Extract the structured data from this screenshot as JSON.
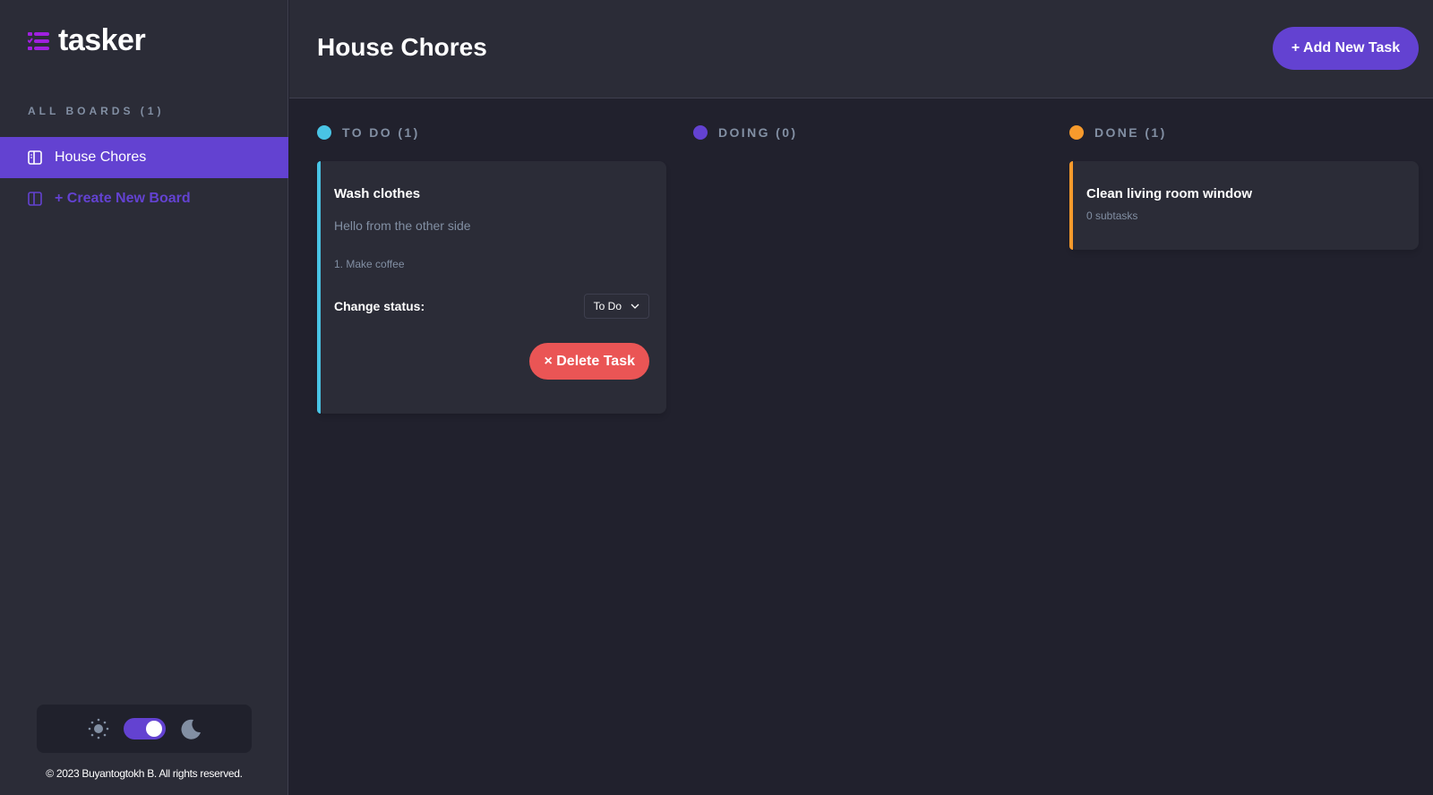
{
  "app": {
    "name": "tasker"
  },
  "sidebar": {
    "all_boards_label": "ALL BOARDS (1)",
    "boards": [
      {
        "label": "House Chores",
        "active": true
      }
    ],
    "create_label": "+ Create New Board",
    "theme": {
      "dark_mode": true
    },
    "footer": "© 2023 Buyantogtokh B. All rights reserved."
  },
  "header": {
    "title": "House Chores",
    "add_task_label": "+ Add New Task"
  },
  "colors": {
    "accent": "#6342d1",
    "todo": "#49c4e5",
    "doing": "#6342d1",
    "done": "#f79a2c",
    "danger": "#ea5555"
  },
  "columns": [
    {
      "label": "TO DO (1)",
      "cards": [
        {
          "title": "Wash clothes",
          "description": "Hello from the other side",
          "subtasks": [
            "1. Make coffee"
          ],
          "status_label": "Change status:",
          "status_value": "To Do",
          "delete_label": "× Delete Task"
        }
      ]
    },
    {
      "label": "DOING (0)",
      "cards": []
    },
    {
      "label": "DONE (1)",
      "cards": [
        {
          "title": "Clean living room window",
          "subtasks_count": "0 subtasks"
        }
      ]
    }
  ]
}
